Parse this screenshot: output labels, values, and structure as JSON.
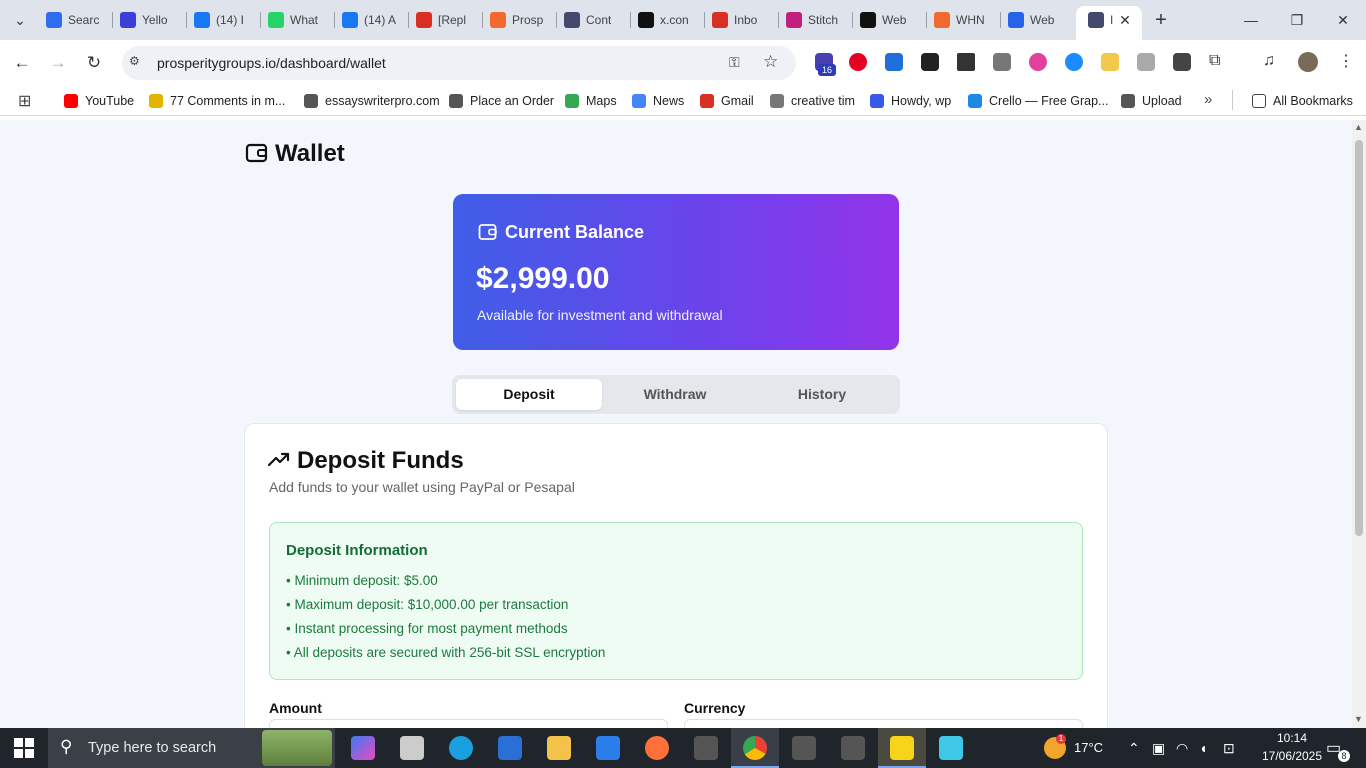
{
  "browser": {
    "tabs": [
      {
        "title": "Searc",
        "favicon": "search-icon",
        "color": "#2f6cf0"
      },
      {
        "title": "Yello",
        "favicon": "heart-icon",
        "color": "#3b3fd6"
      },
      {
        "title": "(14) I",
        "favicon": "facebook-icon",
        "color": "#1877f2"
      },
      {
        "title": "What",
        "favicon": "whatsapp-icon",
        "color": "#25d366"
      },
      {
        "title": "(14) A",
        "favicon": "facebook-icon",
        "color": "#1877f2"
      },
      {
        "title": "[Repl",
        "favicon": "gmail-icon",
        "color": "#d93025"
      },
      {
        "title": "Prosp",
        "favicon": "prosperity-icon",
        "color": "#f26a2e"
      },
      {
        "title": "Cont",
        "favicon": "globe-icon",
        "color": "#444a6e"
      },
      {
        "title": "x.con",
        "favicon": "x-icon",
        "color": "#111111"
      },
      {
        "title": "Inbo",
        "favicon": "gmail-icon",
        "color": "#d93025"
      },
      {
        "title": "Stitch",
        "favicon": "flask-icon",
        "color": "#c2207f"
      },
      {
        "title": "Web",
        "favicon": "wix-icon",
        "color": "#111111"
      },
      {
        "title": "WHN",
        "favicon": "cpanel-icon",
        "color": "#f26a2e"
      },
      {
        "title": "Web",
        "favicon": "webflow-icon",
        "color": "#2563eb"
      },
      {
        "title": "I",
        "favicon": "globe-icon",
        "color": "#444a6e"
      }
    ],
    "url": "prosperitygroups.io/dashboard/wallet",
    "extension_badge": "16",
    "bookmarks": [
      {
        "label": "YouTube",
        "icon": "youtube-icon",
        "color": "#ff0000"
      },
      {
        "label": "77 Comments in m...",
        "icon": "comment-icon",
        "color": "#e2b400"
      },
      {
        "label": "essayswriterpro.com",
        "icon": "globe-icon",
        "color": "#555555"
      },
      {
        "label": "Place an Order",
        "icon": "globe-icon",
        "color": "#555555"
      },
      {
        "label": "Maps",
        "icon": "maps-icon",
        "color": "#34a853"
      },
      {
        "label": "News",
        "icon": "news-icon",
        "color": "#4285f4"
      },
      {
        "label": "Gmail",
        "icon": "gmail-icon",
        "color": "#d93025"
      },
      {
        "label": "creative tim",
        "icon": "creativetim-icon",
        "color": "#777777"
      },
      {
        "label": "Howdy, wp",
        "icon": "wp-icon",
        "color": "#3858e9"
      },
      {
        "label": "Crello — Free Grap...",
        "icon": "crello-icon",
        "color": "#1e88e5"
      },
      {
        "label": "Upload",
        "icon": "globe-icon",
        "color": "#555555"
      }
    ],
    "all_bookmarks_label": "All Bookmarks",
    "more_bookmarks": "»"
  },
  "page": {
    "title": "Wallet",
    "balance": {
      "label": "Current Balance",
      "amount": "$2,999.00",
      "subtitle": "Available for investment and withdrawal"
    },
    "tabs": [
      {
        "label": "Deposit",
        "active": true
      },
      {
        "label": "Withdraw",
        "active": false
      },
      {
        "label": "History",
        "active": false
      }
    ],
    "deposit": {
      "title": "Deposit Funds",
      "subtitle": "Add funds to your wallet using PayPal or Pesapal",
      "info_title": "Deposit Information",
      "info_items": [
        "• Minimum deposit: $5.00",
        "• Maximum deposit: $10,000.00 per transaction",
        "• Instant processing for most payment methods",
        "• All deposits are secured with 256-bit SSL encryption"
      ],
      "amount_label": "Amount",
      "currency_label": "Currency"
    },
    "colors": {
      "accent_start": "#3f5ee8",
      "accent_end": "#9334ea",
      "info_bg": "#effcf3",
      "info_text": "#146c37"
    }
  },
  "taskbar": {
    "search_placeholder": "Type here to search",
    "temperature": "17°C",
    "time": "10:14",
    "date": "17/06/2025",
    "notification_count": "8",
    "weather_badge": "1"
  }
}
